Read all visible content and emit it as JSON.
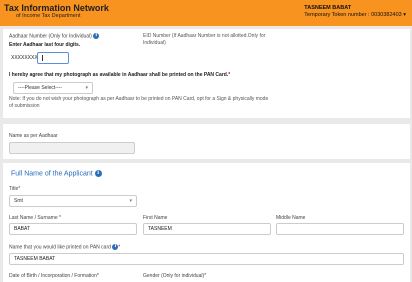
{
  "header": {
    "brand_title": "Tax Information Network",
    "brand_subtitle": "of Income Tax Department",
    "user_name": "TASNEEM BABAT",
    "token_text": "Temporary Token number : 0030382403 ▾"
  },
  "aadhaar_card": {
    "aadhaar_label": "Aadhaar Number (Only for Individual)",
    "last_four_label": "Enter Aadhaar last four digits.",
    "masked_prefix": "XXXXXXXX",
    "last_four_value": "",
    "eid_label": "EID Number (If Aadhaar Number is not allotted.Only for Individual)",
    "photo_consent_label": "I hereby agree that my photograph as available in Aadhaar shall be printed on the PAN Card.",
    "photo_consent_required": "*",
    "photo_consent_select": "----Please Select----",
    "photo_note": "Note: If you do not wish your photograph as per Aadhaar to be printed on PAN Card, opt for a Sign & physically mode of submission"
  },
  "name_aadhaar_card": {
    "label": "Name as per Aadhaar",
    "value": ""
  },
  "applicant_card": {
    "section_title": "Full Name of the Applicant",
    "title_label": "Title*",
    "title_value": "Smt",
    "last_name_label": "Last Name / Surname *",
    "last_name_value": "BABAT",
    "first_name_label": "First Name",
    "first_name_value": "TASNEEM",
    "middle_name_label": "Middle Name",
    "middle_name_value": "",
    "pan_name_label": "Name that you would like printed on PAN card",
    "pan_name_required": "*",
    "pan_name_value": "TASNEEM BABAT",
    "dob_label": "Date of Birth / Incorporation / Formation*",
    "gender_label": "Gender (Only for individual)*"
  },
  "icons": {
    "info": "i",
    "chevron": "▾"
  },
  "colors": {
    "header_bg": "#f7931e",
    "section_title": "#2a6ebb",
    "page_bg": "#e9e9e9"
  }
}
